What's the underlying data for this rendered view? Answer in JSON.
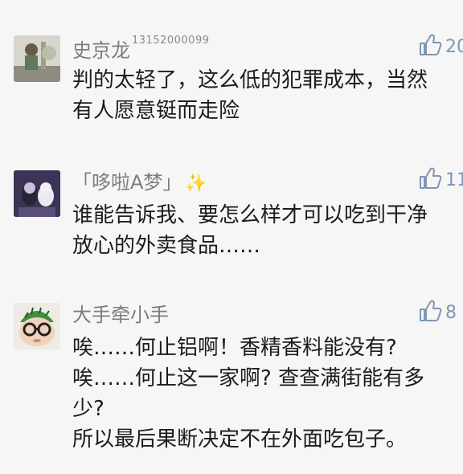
{
  "comments": [
    {
      "user": "史京龙",
      "user_suffix": "13152000099",
      "likes": "20",
      "text": "判的太轻了，这么低的犯罪成本，当然\n有人愿意铤而走险"
    },
    {
      "user": "「哆啦A梦」",
      "sparkle": "✨",
      "likes": "11",
      "text": "谁能告诉我、要怎么样才可以吃到干净\n放心的外卖食品……"
    },
    {
      "user": "大手牵小手",
      "likes": "8",
      "text": "唉……何止铝啊！香精香料能没有?\n唉……何止这一家啊? 查查满街能有多\n少?\n所以最后果断决定不在外面吃包子。"
    }
  ],
  "icons": {
    "like": "thumbs-up-icon"
  },
  "colors": {
    "background": "#f6f6f6",
    "username": "#7d7d7d",
    "like": "#7f96b5",
    "text": "#1c1c1c"
  }
}
